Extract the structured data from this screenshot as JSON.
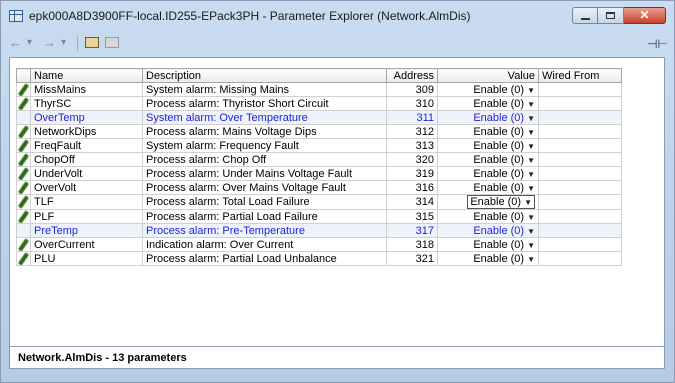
{
  "window": {
    "title": "epk000A8D3900FF-local.ID255-EPack3PH - Parameter Explorer (Network.AlmDis)",
    "close_glyph": "✕"
  },
  "toolbar": {
    "back_icon": "←",
    "back_dropdown_icon": "▾",
    "forward_icon": "→",
    "forward_dropdown_icon": "▾",
    "pin_icon": "⊣⊢"
  },
  "table": {
    "columns": [
      "Name",
      "Description",
      "Address",
      "Value",
      "Wired From"
    ],
    "rows": [
      {
        "name": "MissMains",
        "description": "System alarm: Missing Mains",
        "address": "309",
        "value": "Enable (0)",
        "icon": "pencil",
        "highlight": false
      },
      {
        "name": "ThyrSC",
        "description": "Process alarm: Thyristor Short Circuit",
        "address": "310",
        "value": "Enable (0)",
        "icon": "pencil",
        "highlight": false
      },
      {
        "name": "OverTemp",
        "description": "System alarm: Over Temperature",
        "address": "311",
        "value": "Enable (0)",
        "icon": "",
        "highlight": true
      },
      {
        "name": "NetworkDips",
        "description": "Process alarm: Mains Voltage Dips",
        "address": "312",
        "value": "Enable (0)",
        "icon": "pencil",
        "highlight": false
      },
      {
        "name": "FreqFault",
        "description": "System alarm: Frequency Fault",
        "address": "313",
        "value": "Enable (0)",
        "icon": "pencil",
        "highlight": false
      },
      {
        "name": "ChopOff",
        "description": "Process alarm: Chop Off",
        "address": "320",
        "value": "Enable (0)",
        "icon": "pencil",
        "highlight": false
      },
      {
        "name": "UnderVolt",
        "description": "Process alarm: Under Mains Voltage Fault",
        "address": "319",
        "value": "Enable (0)",
        "icon": "pencil",
        "highlight": false
      },
      {
        "name": "OverVolt",
        "description": "Process alarm: Over Mains Voltage Fault",
        "address": "316",
        "value": "Enable (0)",
        "icon": "pencil",
        "highlight": false
      },
      {
        "name": "TLF",
        "description": "Process alarm: Total Load Failure",
        "address": "314",
        "value": "Enable (0)",
        "icon": "pencil",
        "highlight": false,
        "selected": true
      },
      {
        "name": "PLF",
        "description": "Process alarm: Partial Load Failure",
        "address": "315",
        "value": "Enable (0)",
        "icon": "pencil",
        "highlight": false
      },
      {
        "name": "PreTemp",
        "description": "Process alarm: Pre-Temperature",
        "address": "317",
        "value": "Enable (0)",
        "icon": "",
        "highlight": true
      },
      {
        "name": "OverCurrent",
        "description": "Indication alarm: Over Current",
        "address": "318",
        "value": "Enable (0)",
        "icon": "pencil",
        "highlight": false
      },
      {
        "name": "PLU",
        "description": "Process alarm: Partial Load Unbalance",
        "address": "321",
        "value": "Enable (0)",
        "icon": "pencil",
        "highlight": false
      }
    ]
  },
  "status": {
    "text": "Network.AlmDis  -  13 parameters"
  },
  "colors": {
    "highlight_text": "#1f1fd6",
    "pencil": "#2c6a1b"
  }
}
